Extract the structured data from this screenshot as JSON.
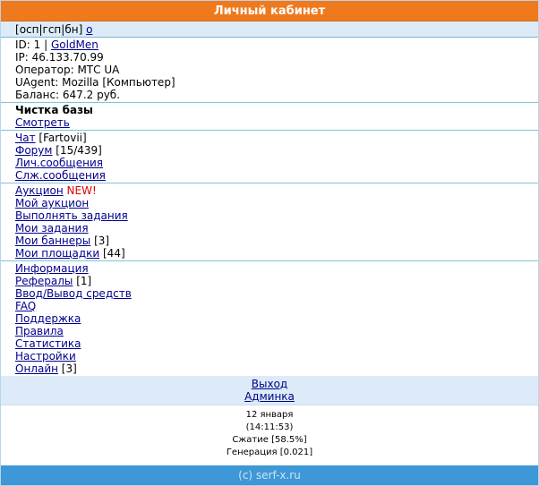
{
  "header": {
    "title": "Личный кабинет"
  },
  "nav": {
    "items": [
      "осп",
      "гсп",
      "бн"
    ],
    "link": "о"
  },
  "user": {
    "id_label": "ID: 1 |",
    "username": "GoldMen",
    "ip": "IP: 46.133.70.99",
    "operator": "Оператор: МТС UA",
    "uagent": "UAgent: Mozilla [Компьютер]",
    "balance": "Баланс: 647.2 руб."
  },
  "cleanup": {
    "title": "Чистка базы",
    "view": "Смотреть"
  },
  "comms": {
    "chat": "Чат",
    "chat_extra": "[Fartovii]",
    "forum": "Форум",
    "forum_extra": "[15/439]",
    "private": "Лич.сообщения",
    "service": "Слж.сообщения"
  },
  "tasks": {
    "auction": "Аукцион",
    "auction_badge": "NEW!",
    "my_auction": "Мой аукцион",
    "do_tasks": "Выполнять задания",
    "my_tasks": "Мои задания",
    "my_banners": "Мои баннеры",
    "my_banners_extra": "[3]",
    "my_sites": "Мои площадки",
    "my_sites_extra": "[44]"
  },
  "info": {
    "information": "Информация",
    "referrals": "Рефералы",
    "referrals_extra": "[1]",
    "io": "Ввод/Вывод средств",
    "faq": "FAQ",
    "support": "Поддержка",
    "rules": "Правила",
    "stats": "Статистика",
    "settings": "Настройки",
    "online": "Онлайн",
    "online_extra": "[3]"
  },
  "exit": {
    "logout": "Выход",
    "admin": "Админка"
  },
  "footer": {
    "date": "12 января",
    "time": "(14:11:53)",
    "compress": "Сжатие [58.5%]",
    "generation": "Генерация [0.021]"
  },
  "copyright": "(c) serf-x.ru"
}
